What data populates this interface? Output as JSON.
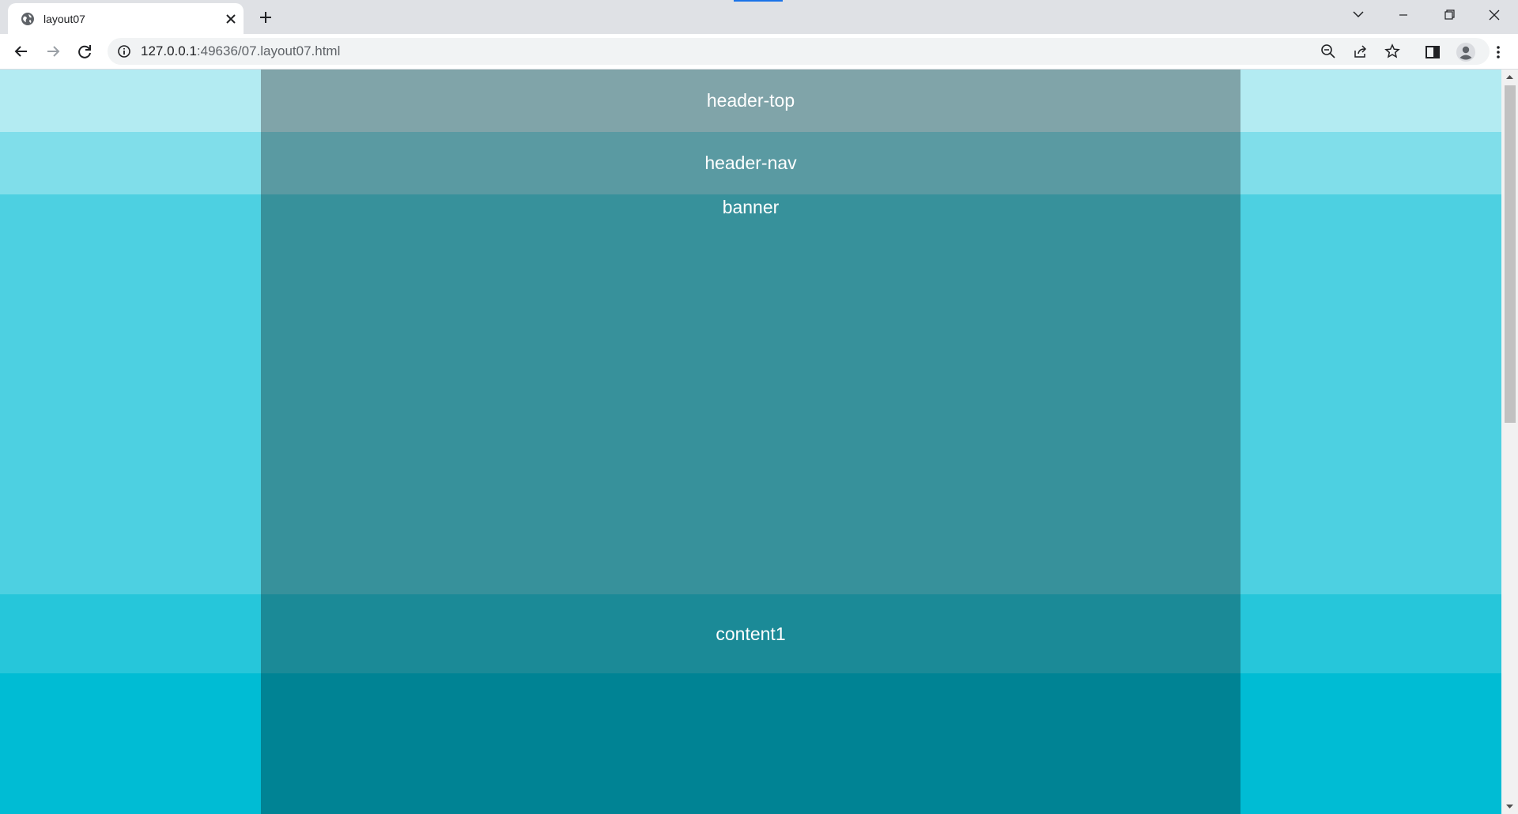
{
  "browser": {
    "tab_title": "layout07",
    "url_host": "127.0.0.1",
    "url_path": ":49636/07.layout07.html"
  },
  "page": {
    "header_top": "header-top",
    "header_nav": "header-nav",
    "banner": "banner",
    "content1": "content1"
  },
  "colors": {
    "header_top_outer": "#b3ebf2",
    "header_top_inner": "#80a4a9",
    "header_nav_outer": "#80deea",
    "header_nav_inner": "#5a9aa2",
    "banner_outer": "#4dd0e1",
    "banner_inner": "#37919b",
    "content1_outer": "#26c6da",
    "content1_inner": "#1b8a97",
    "content2_outer": "#00bcd4",
    "content2_inner": "#008394"
  },
  "icons": [
    "globe-icon",
    "close-icon",
    "plus-icon",
    "chevron-down-icon",
    "minimize-icon",
    "restore-icon",
    "window-close-icon",
    "back-arrow-icon",
    "forward-arrow-icon",
    "reload-icon",
    "info-icon",
    "zoom-out-icon",
    "share-icon",
    "star-icon",
    "side-panel-icon",
    "profile-icon",
    "more-vert-icon"
  ]
}
